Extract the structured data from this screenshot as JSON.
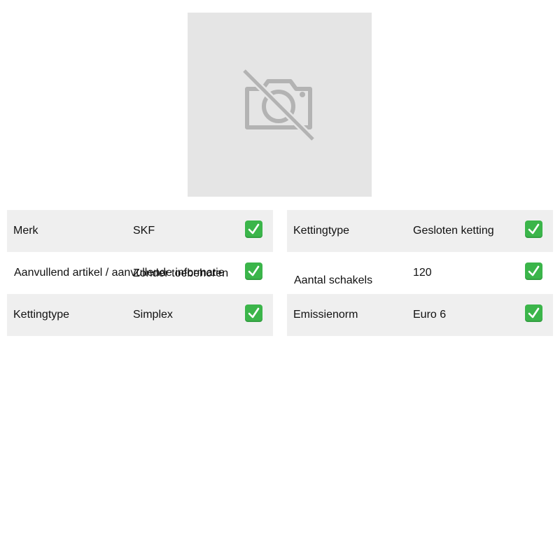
{
  "product_image": {
    "icon": "no-camera-icon",
    "background": "#e5e5e5"
  },
  "check_icon": {
    "name": "check-mark-button-icon",
    "color": "#3bb54a"
  },
  "specs_left": [
    {
      "label": "Merk",
      "value": "SKF",
      "shaded": true
    },
    {
      "label": "Aanvullend artikel / aanvullende informatie",
      "value": "Zonder toebehoren",
      "shaded": false
    },
    {
      "label": "Kettingtype",
      "value": "Simplex",
      "shaded": true
    }
  ],
  "specs_right": [
    {
      "label": "Kettingtype",
      "value": "Gesloten ketting",
      "shaded": true
    },
    {
      "label": "Aantal schakels",
      "value": "120",
      "shaded": false
    },
    {
      "label": "Emissienorm",
      "value": "Euro 6",
      "shaded": true
    }
  ]
}
